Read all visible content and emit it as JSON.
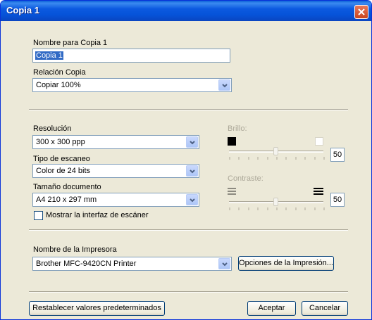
{
  "window": {
    "title": "Copia 1"
  },
  "name_field": {
    "label": "Nombre para Copia 1",
    "value": "Copia 1"
  },
  "ratio": {
    "label": "Relación Copia",
    "value": "Copiar 100%"
  },
  "resolution": {
    "label": "Resolución",
    "value": "300 x 300 ppp"
  },
  "scan_type": {
    "label": "Tipo de escaneo",
    "value": "Color de 24 bits"
  },
  "doc_size": {
    "label": "Tamaño documento",
    "value": "A4 210 x 297 mm"
  },
  "show_scanner_ui": {
    "label": "Mostrar la interfaz de escáner",
    "checked": false
  },
  "brightness": {
    "label": "Brillo:",
    "value": "50",
    "level": 0.5
  },
  "contrast": {
    "label": "Contraste:",
    "value": "50",
    "level": 0.5
  },
  "printer": {
    "label": "Nombre de la Impresora",
    "value": "Brother MFC-9420CN Printer",
    "options_button": "Opciones de la Impresión..."
  },
  "buttons": {
    "reset": "Restablecer valores predeterminados",
    "ok": "Aceptar",
    "cancel": "Cancelar"
  }
}
